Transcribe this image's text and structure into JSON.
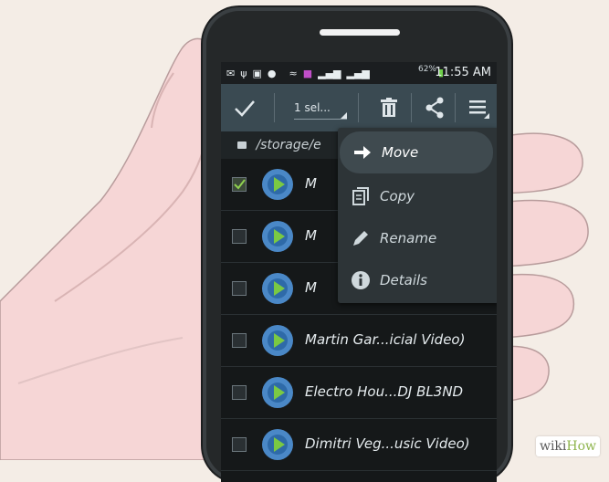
{
  "status_bar": {
    "time": "11:55 AM",
    "battery": "62%"
  },
  "action_bar": {
    "selection_label": "1 sel...",
    "icons": [
      "check-icon",
      "delete-icon",
      "share-icon",
      "overflow-menu-icon"
    ]
  },
  "path": {
    "text": "/storage/e"
  },
  "files": [
    {
      "name": "M",
      "checked": true
    },
    {
      "name": "M",
      "checked": false
    },
    {
      "name": "M",
      "checked": false
    },
    {
      "name": "Martin Gar...icial Video)",
      "checked": false
    },
    {
      "name": "Electro Hou...DJ BL3ND",
      "checked": false
    },
    {
      "name": "Dimitri Veg...usic Video)",
      "checked": false
    }
  ],
  "context_menu": {
    "items": [
      {
        "label": "Move",
        "icon": "arrow-right-icon",
        "highlighted": true
      },
      {
        "label": "Copy",
        "icon": "copy-icon",
        "highlighted": false
      },
      {
        "label": "Rename",
        "icon": "pencil-icon",
        "highlighted": false
      },
      {
        "label": "Details",
        "icon": "info-icon",
        "highlighted": false
      }
    ]
  },
  "watermark": {
    "wiki": "wiki",
    "how": "How"
  },
  "colors": {
    "background": "#f4ede6",
    "skin": "#f6d6d6",
    "phone": "#252829",
    "action_bar": "#3a4a52",
    "menu": "#2d3437",
    "watermark_green": "#8eb44c"
  }
}
